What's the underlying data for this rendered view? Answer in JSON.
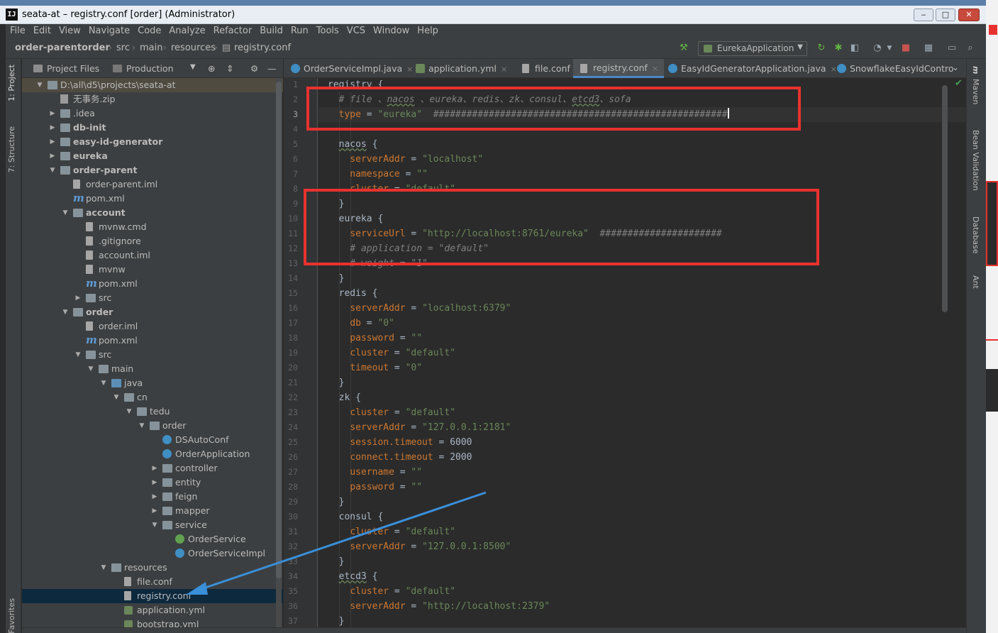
{
  "window": {
    "title": "seata-at – registry.conf [order] (Administrator)",
    "app_icon": "IJ",
    "controls": {
      "minimize": "‒",
      "maximize": "□",
      "close": "✕"
    }
  },
  "menu": [
    "File",
    "Edit",
    "View",
    "Navigate",
    "Code",
    "Analyze",
    "Refactor",
    "Build",
    "Run",
    "Tools",
    "VCS",
    "Window",
    "Help"
  ],
  "breadcrumbs": [
    "order-parent",
    "order",
    "src",
    "main",
    "resources",
    "registry.conf"
  ],
  "run_config": "EurekaApplication",
  "toolstrip_left": {
    "project": "1: Project",
    "structure": "7: Structure",
    "favorites": "Favorites"
  },
  "toolstrip_right": [
    "Maven",
    "Bean Validation",
    "Database",
    "Ant"
  ],
  "project_panel": {
    "view_label": "Project Files",
    "scope_label": "Production",
    "tree": [
      {
        "label": "D:\\all\\d5\\projects\\seata-at",
        "depth": 0,
        "icon": "folder",
        "arrow": "open",
        "root": true
      },
      {
        "label": "无事务.zip",
        "depth": 1,
        "icon": "zip",
        "arrow": ""
      },
      {
        "label": ".idea",
        "depth": 1,
        "icon": "folder",
        "arrow": "closed"
      },
      {
        "label": "db-init",
        "depth": 1,
        "icon": "folder",
        "arrow": "closed",
        "bold": true
      },
      {
        "label": "easy-id-generator",
        "depth": 1,
        "icon": "folder",
        "arrow": "closed",
        "bold": true
      },
      {
        "label": "eureka",
        "depth": 1,
        "icon": "folder",
        "arrow": "closed",
        "bold": true
      },
      {
        "label": "order-parent",
        "depth": 1,
        "icon": "folder",
        "arrow": "open",
        "bold": true
      },
      {
        "label": "order-parent.iml",
        "depth": 2,
        "icon": "file",
        "arrow": ""
      },
      {
        "label": "pom.xml",
        "depth": 2,
        "icon": "maven",
        "arrow": ""
      },
      {
        "label": "account",
        "depth": 2,
        "icon": "folder",
        "arrow": "open",
        "bold": true
      },
      {
        "label": "mvnw.cmd",
        "depth": 3,
        "icon": "file",
        "arrow": ""
      },
      {
        "label": ".gitignore",
        "depth": 3,
        "icon": "file",
        "arrow": ""
      },
      {
        "label": "account.iml",
        "depth": 3,
        "icon": "file",
        "arrow": ""
      },
      {
        "label": "mvnw",
        "depth": 3,
        "icon": "file",
        "arrow": ""
      },
      {
        "label": "pom.xml",
        "depth": 3,
        "icon": "maven",
        "arrow": ""
      },
      {
        "label": "src",
        "depth": 3,
        "icon": "folder",
        "arrow": "closed"
      },
      {
        "label": "order",
        "depth": 2,
        "icon": "folder",
        "arrow": "open",
        "bold": true
      },
      {
        "label": "order.iml",
        "depth": 3,
        "icon": "file",
        "arrow": ""
      },
      {
        "label": "pom.xml",
        "depth": 3,
        "icon": "maven",
        "arrow": ""
      },
      {
        "label": "src",
        "depth": 3,
        "icon": "folder",
        "arrow": "open"
      },
      {
        "label": "main",
        "depth": 4,
        "icon": "folder",
        "arrow": "open"
      },
      {
        "label": "java",
        "depth": 5,
        "icon": "java",
        "arrow": "open"
      },
      {
        "label": "cn",
        "depth": 6,
        "icon": "folder",
        "arrow": "open"
      },
      {
        "label": "tedu",
        "depth": 7,
        "icon": "folder",
        "arrow": "open"
      },
      {
        "label": "order",
        "depth": 8,
        "icon": "folder",
        "arrow": "open"
      },
      {
        "label": "DSAutoConf",
        "depth": 9,
        "icon": "class",
        "arrow": ""
      },
      {
        "label": "OrderApplication",
        "depth": 9,
        "icon": "class",
        "arrow": ""
      },
      {
        "label": "controller",
        "depth": 9,
        "icon": "folder",
        "arrow": "closed"
      },
      {
        "label": "entity",
        "depth": 9,
        "icon": "folder",
        "arrow": "closed"
      },
      {
        "label": "feign",
        "depth": 9,
        "icon": "folder",
        "arrow": "closed"
      },
      {
        "label": "mapper",
        "depth": 9,
        "icon": "folder",
        "arrow": "closed"
      },
      {
        "label": "service",
        "depth": 9,
        "icon": "folder",
        "arrow": "open"
      },
      {
        "label": "OrderService",
        "depth": 10,
        "icon": "iface",
        "arrow": ""
      },
      {
        "label": "OrderServiceImpl",
        "depth": 10,
        "icon": "class",
        "arrow": ""
      },
      {
        "label": "resources",
        "depth": 5,
        "icon": "folder",
        "arrow": "open"
      },
      {
        "label": "file.conf",
        "depth": 6,
        "icon": "file",
        "arrow": ""
      },
      {
        "label": "registry.conf",
        "depth": 6,
        "icon": "file",
        "arrow": "",
        "selected": true
      },
      {
        "label": "application.yml",
        "depth": 6,
        "icon": "yml",
        "arrow": ""
      },
      {
        "label": "bootstrap.yml",
        "depth": 6,
        "icon": "yml",
        "arrow": ""
      }
    ]
  },
  "editor_tabs": [
    {
      "label": "OrderServiceImpl.java",
      "icon": "class",
      "close": "×"
    },
    {
      "label": "application.yml",
      "icon": "yml",
      "close": "×"
    },
    {
      "label": "file.conf",
      "icon": "file",
      "close": "×"
    },
    {
      "label": "registry.conf",
      "icon": "file",
      "close": "×",
      "active": true
    },
    {
      "label": "EasyIdGeneratorApplication.java",
      "icon": "class",
      "close": "×"
    },
    {
      "label": "SnowflakeEasyIdContro",
      "icon": "class",
      "close": ""
    }
  ],
  "editor": {
    "current_line": 3,
    "line_numbers": [
      "1",
      "2",
      "3",
      "4",
      "5",
      "6",
      "7",
      "8",
      "9",
      "10",
      "11",
      "12",
      "13",
      "14",
      "15",
      "16",
      "17",
      "18",
      "19",
      "20",
      "21",
      "22",
      "23",
      "24",
      "25",
      "26",
      "27",
      "28",
      "29",
      "30",
      "31",
      "32",
      "33",
      "34",
      "35",
      "36",
      "37"
    ],
    "lines": [
      [
        [
          "n",
          "registry {"
        ]
      ],
      [
        [
          "n",
          "  "
        ],
        [
          "c",
          "# file 、"
        ],
        [
          "c ul",
          "nacos"
        ],
        [
          "c",
          " 、eureka、redis、zk、consul、"
        ],
        [
          "c ul",
          "etcd3"
        ],
        [
          "c",
          "、sofa"
        ]
      ],
      [
        [
          "n",
          "  "
        ],
        [
          "k",
          "type"
        ],
        [
          "n",
          " = "
        ],
        [
          "s",
          "\"eureka\""
        ],
        [
          "n",
          "  "
        ],
        [
          "c",
          "#####################################################"
        ],
        [
          "caret",
          ""
        ]
      ],
      [
        [
          "n",
          ""
        ]
      ],
      [
        [
          "n",
          "  "
        ],
        [
          "n ul",
          "nacos"
        ],
        [
          "n",
          " {"
        ]
      ],
      [
        [
          "n",
          "    "
        ],
        [
          "k",
          "serverAddr"
        ],
        [
          "n",
          " = "
        ],
        [
          "s",
          "\"localhost\""
        ]
      ],
      [
        [
          "n",
          "    "
        ],
        [
          "k",
          "namespace"
        ],
        [
          "n",
          " = "
        ],
        [
          "s",
          "\"\""
        ]
      ],
      [
        [
          "n",
          "    "
        ],
        [
          "k",
          "cluster"
        ],
        [
          "n",
          " = "
        ],
        [
          "s",
          "\"default\""
        ]
      ],
      [
        [
          "n",
          "  }"
        ]
      ],
      [
        [
          "n",
          "  eureka {"
        ]
      ],
      [
        [
          "n",
          "    "
        ],
        [
          "k",
          "serviceUrl"
        ],
        [
          "n",
          " = "
        ],
        [
          "s",
          "\"http://localhost:8761/eureka\""
        ],
        [
          "n",
          "  "
        ],
        [
          "c",
          "######################"
        ]
      ],
      [
        [
          "n",
          "    "
        ],
        [
          "c",
          "# application = \"default\""
        ]
      ],
      [
        [
          "n",
          "    "
        ],
        [
          "c",
          "# weight = \"1\""
        ]
      ],
      [
        [
          "n",
          "  }"
        ]
      ],
      [
        [
          "n",
          "  redis {"
        ]
      ],
      [
        [
          "n",
          "    "
        ],
        [
          "k",
          "serverAddr"
        ],
        [
          "n",
          " = "
        ],
        [
          "s",
          "\"localhost:6379\""
        ]
      ],
      [
        [
          "n",
          "    "
        ],
        [
          "k",
          "db"
        ],
        [
          "n",
          " = "
        ],
        [
          "s",
          "\"0\""
        ]
      ],
      [
        [
          "n",
          "    "
        ],
        [
          "k",
          "password"
        ],
        [
          "n",
          " = "
        ],
        [
          "s",
          "\"\""
        ]
      ],
      [
        [
          "n",
          "    "
        ],
        [
          "k",
          "cluster"
        ],
        [
          "n",
          " = "
        ],
        [
          "s",
          "\"default\""
        ]
      ],
      [
        [
          "n",
          "    "
        ],
        [
          "k",
          "timeout"
        ],
        [
          "n",
          " = "
        ],
        [
          "s",
          "\"0\""
        ]
      ],
      [
        [
          "n",
          "  }"
        ]
      ],
      [
        [
          "n",
          "  zk {"
        ]
      ],
      [
        [
          "n",
          "    "
        ],
        [
          "k",
          "cluster"
        ],
        [
          "n",
          " = "
        ],
        [
          "s",
          "\"default\""
        ]
      ],
      [
        [
          "n",
          "    "
        ],
        [
          "k",
          "serverAddr"
        ],
        [
          "n",
          " = "
        ],
        [
          "s",
          "\"127.0.0.1:2181\""
        ]
      ],
      [
        [
          "n",
          "    "
        ],
        [
          "k",
          "session.timeout"
        ],
        [
          "n",
          " = 6000"
        ]
      ],
      [
        [
          "n",
          "    "
        ],
        [
          "k",
          "connect.timeout"
        ],
        [
          "n",
          " = 2000"
        ]
      ],
      [
        [
          "n",
          "    "
        ],
        [
          "k",
          "username"
        ],
        [
          "n",
          " = "
        ],
        [
          "s",
          "\"\""
        ]
      ],
      [
        [
          "n",
          "    "
        ],
        [
          "k",
          "password"
        ],
        [
          "n",
          " = "
        ],
        [
          "s",
          "\"\""
        ]
      ],
      [
        [
          "n",
          "  }"
        ]
      ],
      [
        [
          "n",
          "  consul {"
        ]
      ],
      [
        [
          "n",
          "    "
        ],
        [
          "k",
          "cluster"
        ],
        [
          "n",
          " = "
        ],
        [
          "s",
          "\"default\""
        ]
      ],
      [
        [
          "n",
          "    "
        ],
        [
          "k",
          "serverAddr"
        ],
        [
          "n",
          " = "
        ],
        [
          "s",
          "\"127.0.0.1:8500\""
        ]
      ],
      [
        [
          "n",
          "  }"
        ]
      ],
      [
        [
          "n",
          "  "
        ],
        [
          "n ul",
          "etcd3"
        ],
        [
          "n",
          " {"
        ]
      ],
      [
        [
          "n",
          "    "
        ],
        [
          "k",
          "cluster"
        ],
        [
          "n",
          " = "
        ],
        [
          "s",
          "\"default\""
        ]
      ],
      [
        [
          "n",
          "    "
        ],
        [
          "k",
          "serverAddr"
        ],
        [
          "n",
          " = "
        ],
        [
          "s",
          "\"http://localhost:2379\""
        ]
      ],
      [
        [
          "n",
          "  }"
        ]
      ]
    ]
  },
  "annotations": {
    "box_color": "#e8322f",
    "arrow_color": "#3a8fd9"
  },
  "colors": {
    "keyword": "#cc7832",
    "string": "#6a8759",
    "comment": "#808080",
    "plain": "#a9b7c6",
    "selection": "#0d293e"
  }
}
